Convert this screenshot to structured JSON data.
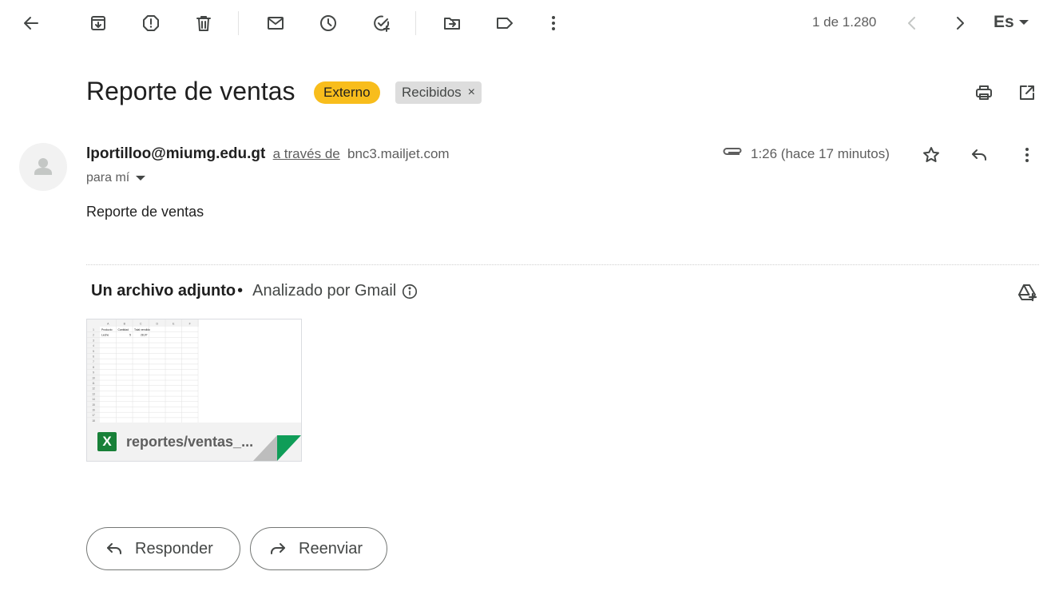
{
  "toolbar": {
    "back_icon": "arrow-left-icon",
    "actions": [
      "archive-icon",
      "report-spam-icon",
      "trash-icon",
      "mark-unread-icon",
      "snooze-icon",
      "add-task-icon",
      "move-to-icon",
      "label-icon",
      "more-vert-icon"
    ],
    "pager_text": "1 de 1.280",
    "input_tool_label": "Es"
  },
  "email": {
    "subject": "Reporte de ventas",
    "labels": {
      "external": "Externo",
      "inbox": "Recibidos",
      "remove_symbol": "×"
    },
    "sender": {
      "address": "lportilloo@miumg.edu.gt",
      "via_text": "a través de",
      "via_domain": "bnc3.mailjet.com"
    },
    "recipient_text": "para mí",
    "timestamp": "1:26 (hace 17 minutos)",
    "body": "Reporte de ventas"
  },
  "attachments": {
    "count_text": "Un archivo adjunto",
    "bullet": "•",
    "scan_text": "Analizado por Gmail",
    "file": {
      "type_badge": "X",
      "name": "reportes/ventas_...",
      "preview": {
        "columns": [
          "A",
          "B",
          "C",
          "D",
          "E",
          "F"
        ],
        "rows": [
          [
            "Producto",
            "Cantidad",
            "Total vendido",
            "",
            "",
            ""
          ],
          [
            "Leche",
            "5",
            "28,97",
            "",
            "",
            ""
          ]
        ],
        "row_numbers": [
          "1",
          "2",
          "3",
          "4",
          "5",
          "6",
          "7",
          "8",
          "9",
          "10",
          "11",
          "12",
          "13",
          "14",
          "15",
          "16",
          "17",
          "18"
        ]
      }
    }
  },
  "actions": {
    "reply_label": "Responder",
    "forward_label": "Reenviar"
  },
  "colors": {
    "external_chip": "#f8bd1c",
    "inbox_chip": "#dddddd",
    "excel_green": "#188038"
  }
}
